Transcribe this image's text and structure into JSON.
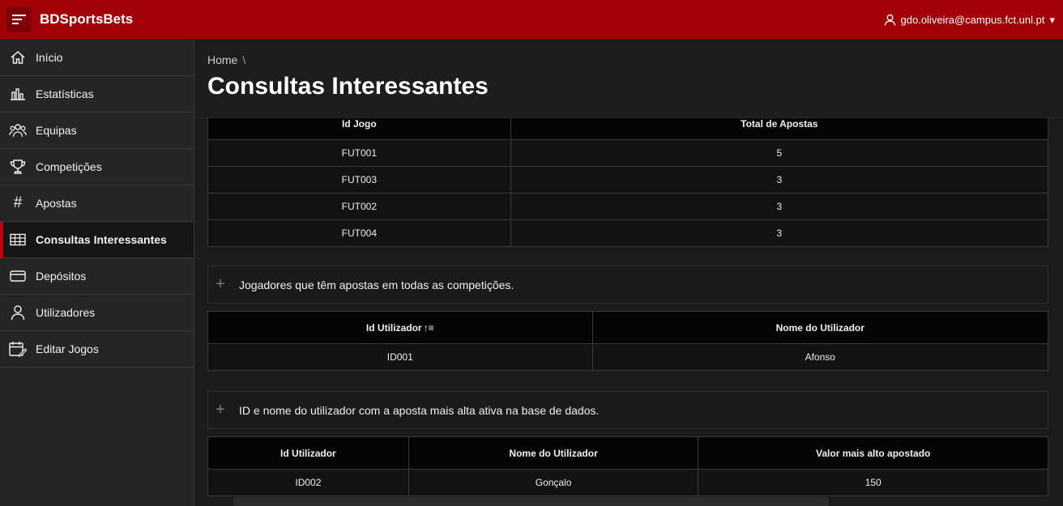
{
  "header": {
    "app_title": "BDSportsBets",
    "user_email": "gdo.oliveira@campus.fct.unl.pt",
    "user_caret": "▾"
  },
  "sidebar": {
    "items": [
      {
        "label": "Início",
        "icon": "home-icon"
      },
      {
        "label": "Estatísticas",
        "icon": "bar-chart-icon"
      },
      {
        "label": "Equipas",
        "icon": "users-icon"
      },
      {
        "label": "Competições",
        "icon": "trophy-icon"
      },
      {
        "label": "Apostas",
        "icon": "hash-icon"
      },
      {
        "label": "Consultas Interessantes",
        "icon": "table-icon",
        "active": true
      },
      {
        "label": "Depósitos",
        "icon": "credit-card-icon"
      },
      {
        "label": "Utilizadores",
        "icon": "user-icon"
      },
      {
        "label": "Editar Jogos",
        "icon": "calendar-edit-icon"
      }
    ]
  },
  "page": {
    "breadcrumb": "Home",
    "breadcrumb_sep": "\\",
    "title": "Consultas Interessantes"
  },
  "table1": {
    "columns": [
      "Id Jogo",
      "Total de Apostas"
    ],
    "rows": [
      [
        "FUT001",
        "5"
      ],
      [
        "FUT003",
        "3"
      ],
      [
        "FUT002",
        "3"
      ],
      [
        "FUT004",
        "3"
      ]
    ]
  },
  "region2": {
    "title": "Jogadores que têm apostas em todas as competições.",
    "toggle": "+"
  },
  "table2": {
    "columns": [
      "Id Utilizador",
      "Nome do Utilizador"
    ],
    "sort_indicator": "↑≡",
    "rows": [
      [
        "ID001",
        "Afonso"
      ]
    ]
  },
  "region3": {
    "title": "ID e nome do utilizador com a aposta mais alta ativa na base de dados.",
    "toggle": "+"
  },
  "table3": {
    "columns": [
      "Id Utilizador",
      "Nome do Utilizador",
      "Valor mais alto apostado"
    ],
    "rows": [
      [
        "ID002",
        "Gonçalo",
        "150"
      ]
    ]
  },
  "colors": {
    "header_bg": "#a10208",
    "active_accent": "#c4000d"
  }
}
